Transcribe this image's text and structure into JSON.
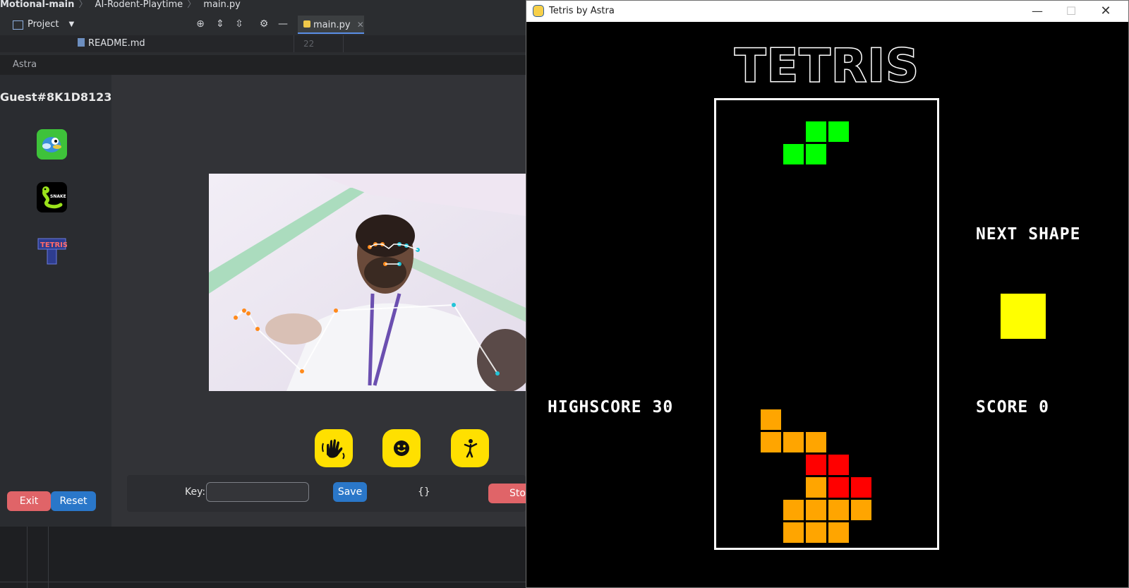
{
  "ide": {
    "breadcrumbs": [
      "Motional-main",
      "AI-Rodent-Playtime",
      "main.py"
    ],
    "project_label": "Project",
    "editor_tab": "main.py",
    "readme_file": "README.md",
    "line_number": "22"
  },
  "astra": {
    "window_title": "Astra",
    "guest_name": "Guest#8K1D8123",
    "games": [
      "flappy-bird",
      "snake",
      "tetris"
    ],
    "snake_icon_text": "SNAKE",
    "tetris_icon_text": "TETRIS",
    "exit_label": "Exit",
    "reset_label": "Reset",
    "key_label": "Key:",
    "key_value": "",
    "save_label": "Save",
    "output_text": "{}",
    "stop_label": "Sto",
    "gesture_buttons": [
      "wave-hand-icon",
      "smiley-icon",
      "person-pose-icon"
    ]
  },
  "tetris": {
    "window_title": "Tetris by Astra",
    "logo": "TETRIS",
    "next_label": "NEXT SHAPE",
    "highscore_label": "HIGHSCORE 30",
    "score_label": "SCORE 0",
    "next_shape_color": "#ffff00",
    "falling_piece": {
      "shape": "S",
      "color": "#00ff00"
    },
    "stack_colors": {
      "orange": "#ffa500",
      "red": "#ff0000"
    }
  },
  "colors": {
    "gesture_button": "#ffe000",
    "exit_button": "#e06468",
    "save_button": "#2a77c9"
  }
}
